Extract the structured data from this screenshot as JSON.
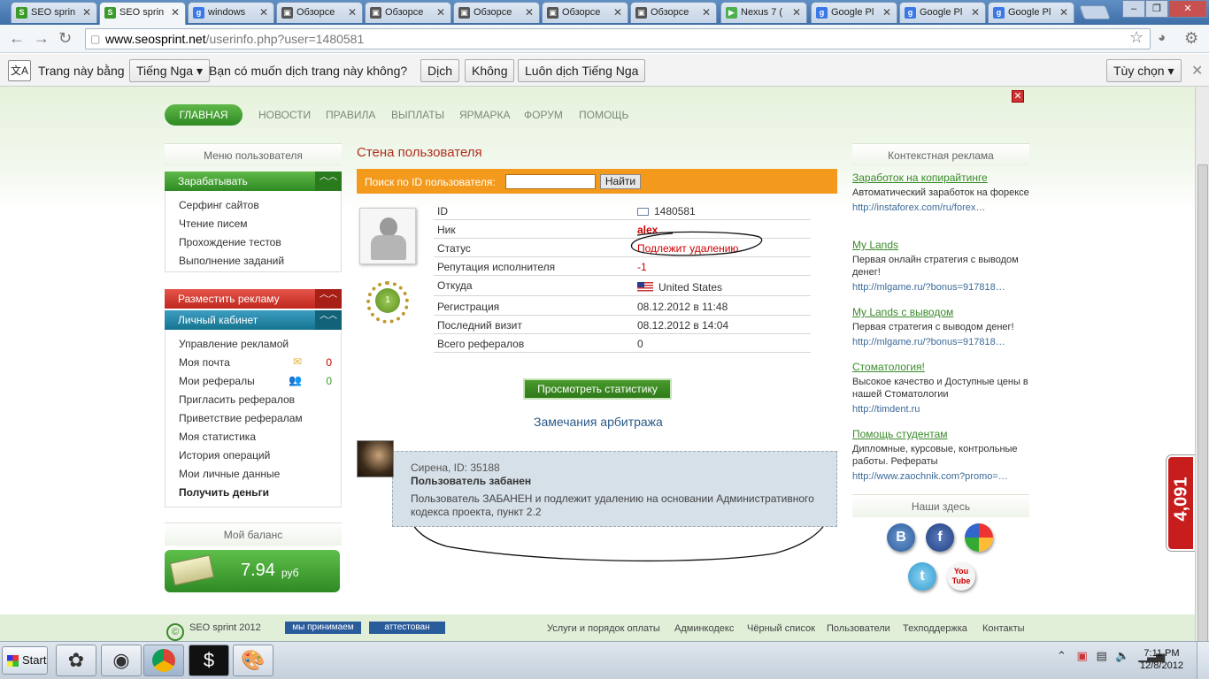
{
  "tabs": [
    {
      "label": "SEO sprin",
      "fav": "S",
      "color": "#3a9a2a"
    },
    {
      "label": "SEO sprin",
      "fav": "S",
      "color": "#3a9a2a",
      "active": true
    },
    {
      "label": "windows",
      "fav": "g",
      "color": "#3b78e7"
    },
    {
      "label": "Обзорсе",
      "fav": "▣",
      "color": "#555"
    },
    {
      "label": "Обзорсе",
      "fav": "▣",
      "color": "#555"
    },
    {
      "label": "Обзорсе",
      "fav": "▣",
      "color": "#555"
    },
    {
      "label": "Обзорсе",
      "fav": "▣",
      "color": "#555"
    },
    {
      "label": "Обзорсе",
      "fav": "▣",
      "color": "#555"
    },
    {
      "label": "Nexus 7 (",
      "fav": "▶",
      "color": "#4caf50"
    },
    {
      "label": "Google Pl",
      "fav": "g",
      "color": "#3b78e7"
    },
    {
      "label": "Google Pl",
      "fav": "g",
      "color": "#3b78e7"
    },
    {
      "label": "Google Pl",
      "fav": "g",
      "color": "#3b78e7"
    }
  ],
  "address": {
    "host": "www.seosprint.net",
    "path": "/userinfo.php?user=1480581"
  },
  "translate": {
    "prefix": "Trang này bằng",
    "lang": "Tiếng Nga ▾",
    "question": "Bạn có muốn dịch trang này không?",
    "translate_btn": "Dịch",
    "no_btn": "Không",
    "always_btn": "Luôn dịch Tiếng Nga",
    "options_btn": "Tùy chọn ▾"
  },
  "nav": {
    "home": "ГЛАВНАЯ",
    "items": [
      "НОВОСТИ",
      "ПРАВИЛА",
      "ВЫПЛАТЫ",
      "ЯРМАРКА",
      "ФОРУМ",
      "ПОМОЩЬ"
    ]
  },
  "left": {
    "menu_title": "Меню пользователя",
    "earn": "Зарабатывать",
    "earn_items": [
      "Серфинг сайтов",
      "Чтение писем",
      "Прохождение тестов",
      "Выполнение заданий"
    ],
    "advertise": "Разместить рекламу",
    "cabinet": "Личный кабинет",
    "cabinet_items": [
      "Управление рекламой",
      "Моя почта",
      "Мои рефералы",
      "Пригласить рефералов",
      "Приветствие рефералам",
      "Моя статистика",
      "История операций",
      "Мои личные данные",
      "Получить деньги"
    ],
    "mail_count": "0",
    "ref_count": "0",
    "balance_title": "Мой баланс",
    "balance_value": "7.94",
    "balance_currency": "руб"
  },
  "wall": {
    "title": "Стена пользователя",
    "search_label": "Поиск по ID пользователя:",
    "search_btn": "Найти",
    "medal_num": "1",
    "rows": [
      {
        "k": "ID",
        "v": "1480581"
      },
      {
        "k": "Ник",
        "v": "alex"
      },
      {
        "k": "Статус",
        "v": "Подлежит удалению"
      },
      {
        "k": "Репутация исполнителя",
        "v": "-1"
      },
      {
        "k": "Откуда",
        "v": "United States"
      },
      {
        "k": "Регистрация",
        "v": "08.12.2012 в 11:48"
      },
      {
        "k": "Последний визит",
        "v": "08.12.2012 в 14:04"
      },
      {
        "k": "Всего рефералов",
        "v": "0"
      }
    ],
    "stats_btn": "Просмотреть статистику",
    "arbitrage": "Замечания арбитража",
    "comment_who": "Сирена, ID: 35188",
    "comment_title": "Пользователь забанен",
    "comment_body": "Пользователь ЗАБАНЕН и подлежит удалению на основании Административного кодекса проекта, пункт 2.2"
  },
  "right": {
    "ads_title": "Контекстная реклама",
    "ads": [
      {
        "t": "Заработок на копирайтинге",
        "d": "Автоматический заработок на форексе",
        "u": "http://instaforex.com/ru/forex…"
      },
      {
        "t": "My Lands",
        "d": "Первая онлайн стратегия с выводом денег!",
        "u": "http://mlgame.ru/?bonus=917818…"
      },
      {
        "t": "My Lands с выводом",
        "d": "Первая стратегия с выводом денег!",
        "u": "http://mlgame.ru/?bonus=917818…"
      },
      {
        "t": "Стоматология!",
        "d": "Высокое качество и Доступные цены в нашей Стоматологии",
        "u": "http://timdent.ru"
      },
      {
        "t": "Помощь студентам",
        "d": "Дипломные, курсовые, контрольные работы. Рефераты",
        "u": "http://www.zaochnik.com?promo=…"
      }
    ],
    "social_title": "Наши здесь",
    "vk": "B",
    "fb": "f",
    "tw": "t",
    "yt": "You Tube"
  },
  "footer": {
    "copy": "SEO sprint 2012",
    "badge1": "мы принимаем",
    "badge2": "аттестован",
    "links": [
      "Услуги и порядок оплаты",
      "Админкодекс",
      "Чёрный список",
      "Пользователи",
      "Техподдержка",
      "Контакты"
    ]
  },
  "side_counter": "4,091",
  "taskbar": {
    "start": "Start",
    "time": "7:11 PM",
    "date": "12/8/2012"
  }
}
